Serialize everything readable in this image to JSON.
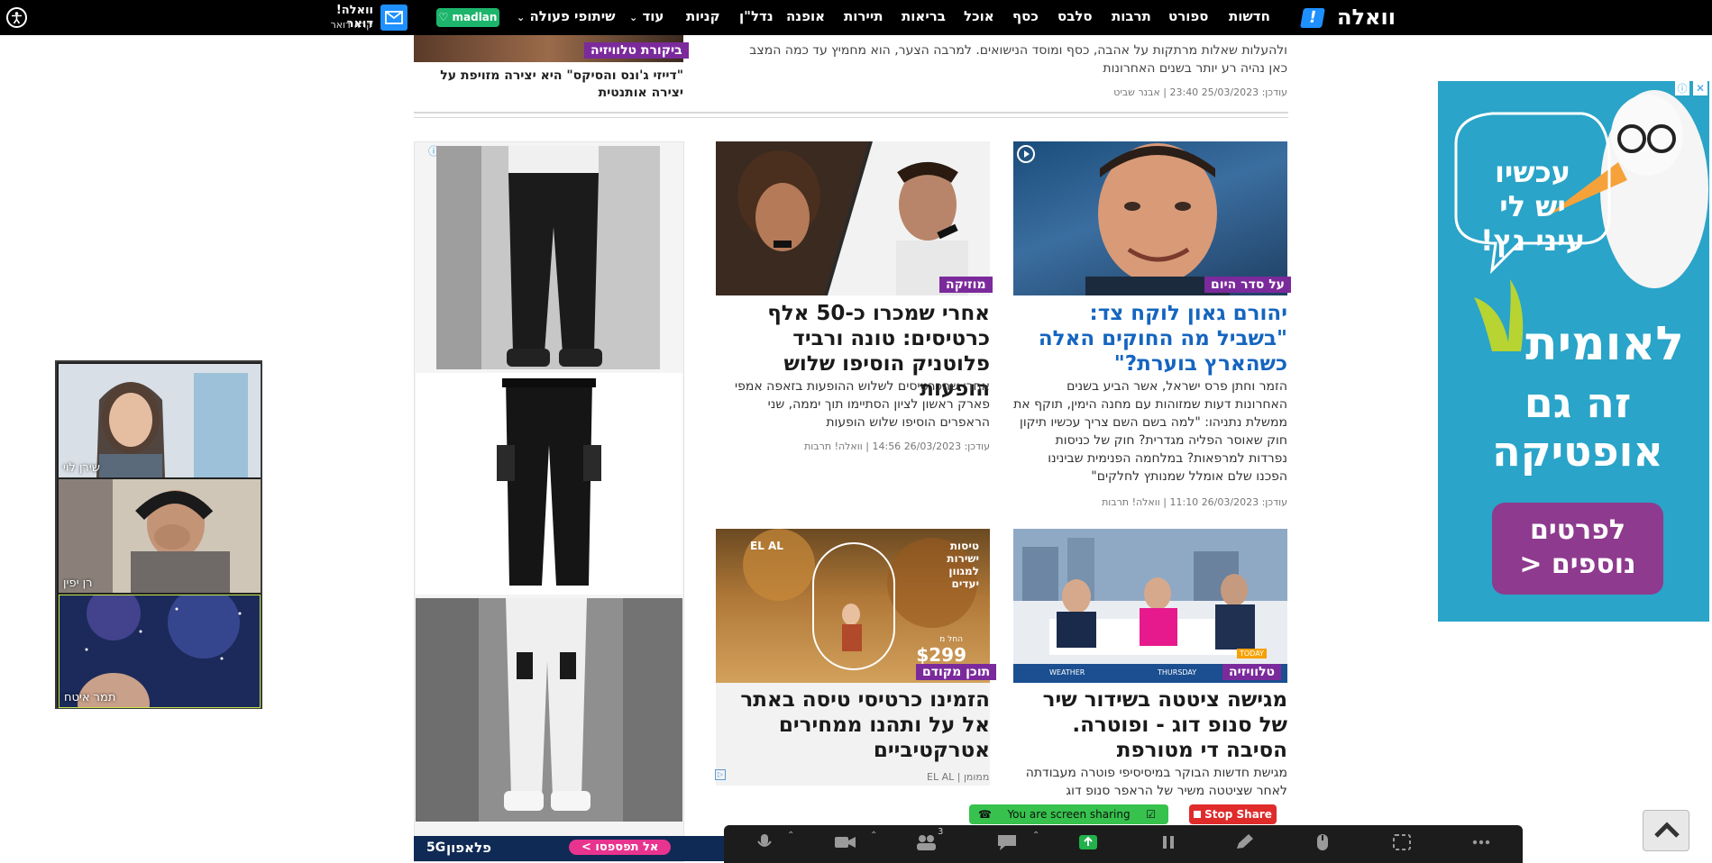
{
  "nav": {
    "logo": "וואלה",
    "items": [
      "חדשות",
      "ספורט",
      "תרבות",
      "סלבס",
      "כסף",
      "אוכל",
      "בריאות",
      "תיירות",
      "אופנה",
      "נדל\"ן",
      "קניות",
      "עוד",
      "שיתופי פעולה"
    ],
    "madlan": "madlan",
    "mail_title": "וואלה! דואר",
    "mail_sub": "קרא דואר"
  },
  "top_section": {
    "right_snippet_lines": [
      "ולהעלות שאלות מרתקות על אהבה, כסף ומוסד הנישואים. למרבה הצער, הוא מחמיץ עד כמה המצב",
      "כאן נהיה רע יותר בשנים האחרונות"
    ],
    "right_meta_date": "עודכן: 25/03/2023 23:40",
    "right_meta_author": "אבנר שביט",
    "left_badge": "ביקורת טלוויזיה",
    "left_title": "\"דייזי ג'ונס והסיקס\" היא יצירה מזויפת על יצירה אותנטית"
  },
  "articles": [
    {
      "badge": "על סדר היום",
      "title": "יהורם גאון לוקח צד: \"בשביל מה החוקים האלה כשהארץ בוערת?\"",
      "summary": "הזמר וחתן פרס ישראל, אשר הביע בשנים האחרונות דעות שמזוהות עם מחנה הימין, תוקף את ממשלת נתניהו: \"למה בשם השם צריך עכשיו תיקון חוק שאוסר הפליה מגדרית? חוק של כניסות נפרדות למרפאות? במלחמה הפנימית שבינינו הפכנו שלם אומלל שמנותץ לחלקים\"",
      "date": "עודכן: 26/03/2023 11:10",
      "source": "וואלה! תרבות"
    },
    {
      "badge": "מוזיקה",
      "title": "אחרי שמכרו כ-50 אלף כרטיסים: טונה ורביד פלוטניק הוסיפו שלוש הופעות",
      "summary": "אחרי שהכרטיסים לשלוש ההופעות בזאפה אמפי פארק ראשון לציון הסתיימו תוך יממה, שני הראפרים הוסיפו שלוש הופעות",
      "date": "עודכן: 26/03/2023 14:56",
      "source": "וואלה! תרבות"
    },
    {
      "badge": "טלוויזיה",
      "title": "מגישה ציטטה בשידור שיר של סנופ דוג - ופוטרה. הסיבה די מטורפת",
      "summary": "מגישת חדשות הבוקר במיסיסיפי פוטרה מעבודתה לאחר שציטטה משיר של הראפר סנופ דוג",
      "screen_caption_1": "TODAY",
      "screen_caption_2": "WEATHER",
      "screen_caption_3": "THURSDAY"
    },
    {
      "badge": "תוכן מקודם",
      "title": "הזמינו כרטיסי טיסה באתר אל על ותהנו ממחירים אטרקטיביים",
      "sponsor": "EL AL | ממומן",
      "ad_lines": [
        "טיסות",
        "ישירות",
        "למגוון",
        "יעדים"
      ],
      "ad_price": "$299",
      "ad_from": "החל מ"
    }
  ],
  "right_ad": {
    "lines": [
      "עכשיו",
      "יש לי",
      "עיני נץ!"
    ],
    "brand": "לאומית",
    "tag1": "זה גם",
    "tag2": "אופטיקה",
    "cta": "לפרטים נוספים <"
  },
  "video_tiles": [
    {
      "name": "שירן לוי"
    },
    {
      "name": "רן יפין"
    },
    {
      "name": "תמר איטח"
    }
  ],
  "zoom": {
    "sharing_label": "You are screen sharing",
    "stop_label": "Stop Share",
    "participants_count": "3",
    "buttons": [
      "Mute",
      "Stop Video",
      "Participants",
      "Chat",
      "New Share",
      "Pause Share",
      "Annotate",
      "Remote Control",
      "Apps",
      "More"
    ]
  },
  "bottom_banner": {
    "brand": "פלאפון",
    "g5": "5G",
    "cta": "אל תפספסו >"
  },
  "colors": {
    "badge": "#7b2a9c",
    "headline_blue": "#1565c0",
    "nav_bg": "#000000",
    "mail_blue": "#1e90ff",
    "madlan_green": "#1db56c",
    "zoom_green": "#36c24c",
    "zoom_red": "#e02b2b"
  }
}
